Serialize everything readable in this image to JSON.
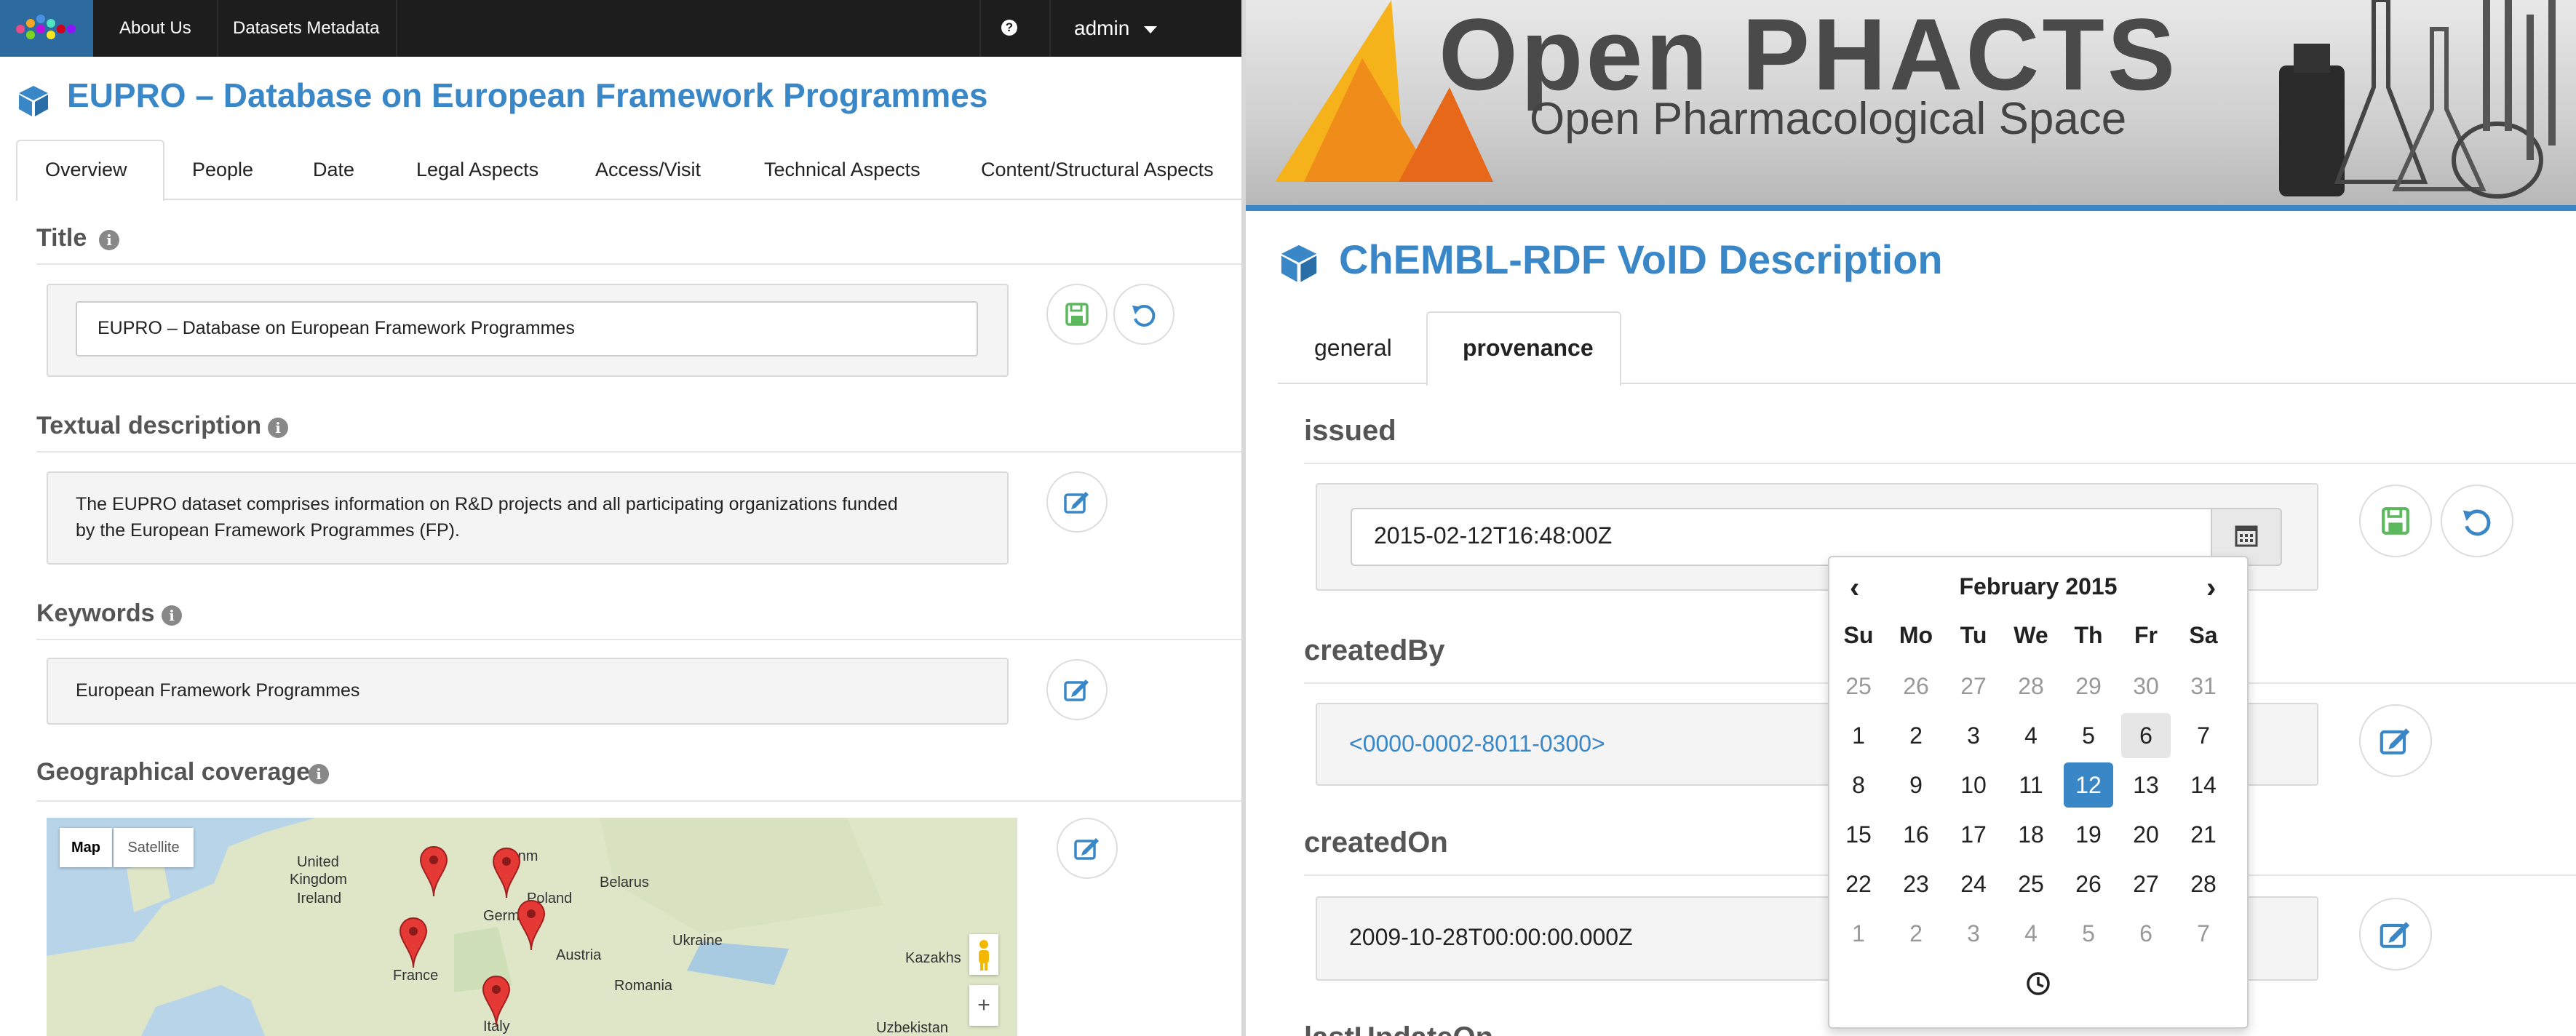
{
  "left": {
    "nav": {
      "about": "About Us",
      "metadata": "Datasets Metadata",
      "help_icon": "question-circle-icon",
      "user": "admin"
    },
    "title": "EUPRO – Database on European Framework Programmes",
    "tabs": [
      "Overview",
      "People",
      "Date",
      "Legal Aspects",
      "Access/Visit",
      "Technical Aspects",
      "Content/Structural Aspects"
    ],
    "active_tab": "Overview",
    "sections": {
      "title": {
        "label": "Title",
        "value": "EUPRO – Database on European Framework Programmes"
      },
      "description": {
        "label": "Textual description",
        "line1": "The EUPRO dataset comprises information on R&D projects and all participating organizations funded",
        "line2": "by the European Framework Programmes (FP)."
      },
      "keywords": {
        "label": "Keywords",
        "value": "European Framework Programmes"
      },
      "geo": {
        "label": "Geographical coverage"
      }
    },
    "map": {
      "map_button": "Map",
      "satellite_button": "Satellite",
      "labels": {
        "ireland": "Ireland",
        "uk1": "United",
        "uk2": "Kingdom",
        "denmark": "Denm",
        "belarus": "Belarus",
        "poland": "Poland",
        "germany": "Germany",
        "ukraine": "Ukraine",
        "france": "France",
        "austria": "Austria",
        "romania": "Romania",
        "italy": "Italy",
        "kazakh": "Kazakhs",
        "uzbek": "Uzbekistan"
      },
      "zoom_in": "+"
    },
    "icons": {
      "save": "save-icon",
      "undo": "undo-icon",
      "edit": "edit-icon",
      "info": "info-icon"
    }
  },
  "right": {
    "brand": {
      "title": "Open PHACTS",
      "subtitle": "Open Pharmacological Space"
    },
    "title": "ChEMBL-RDF VoID Description",
    "tabs": [
      "general",
      "provenance"
    ],
    "active_tab": "provenance",
    "issued": {
      "label": "issued",
      "value": "2015-02-12T16:48:00Z"
    },
    "createdBy": {
      "label": "createdBy",
      "value": "<0000-0002-8011-0300>"
    },
    "createdOn": {
      "label": "createdOn",
      "value": "2009-10-28T00:00:00.000Z"
    },
    "lastUpdateOn": {
      "label": "lastUpdateOn"
    },
    "datepicker": {
      "month": "February 2015",
      "prev": "‹",
      "next": "›",
      "days": [
        "Su",
        "Mo",
        "Tu",
        "We",
        "Th",
        "Fr",
        "Sa"
      ],
      "weeks": [
        [
          "25",
          "26",
          "27",
          "28",
          "29",
          "30",
          "31"
        ],
        [
          "1",
          "2",
          "3",
          "4",
          "5",
          "6",
          "7"
        ],
        [
          "8",
          "9",
          "10",
          "11",
          "12",
          "13",
          "14"
        ],
        [
          "15",
          "16",
          "17",
          "18",
          "19",
          "20",
          "21"
        ],
        [
          "22",
          "23",
          "24",
          "25",
          "26",
          "27",
          "28"
        ],
        [
          "1",
          "2",
          "3",
          "4",
          "5",
          "6",
          "7"
        ]
      ],
      "selected": "12",
      "today": "6",
      "clock_icon": "clock-icon"
    }
  },
  "colors": {
    "accent": "#3a87c8",
    "save_green": "#5cb85c",
    "marker_red": "#e53935",
    "navbar": "#1d1d1d"
  }
}
